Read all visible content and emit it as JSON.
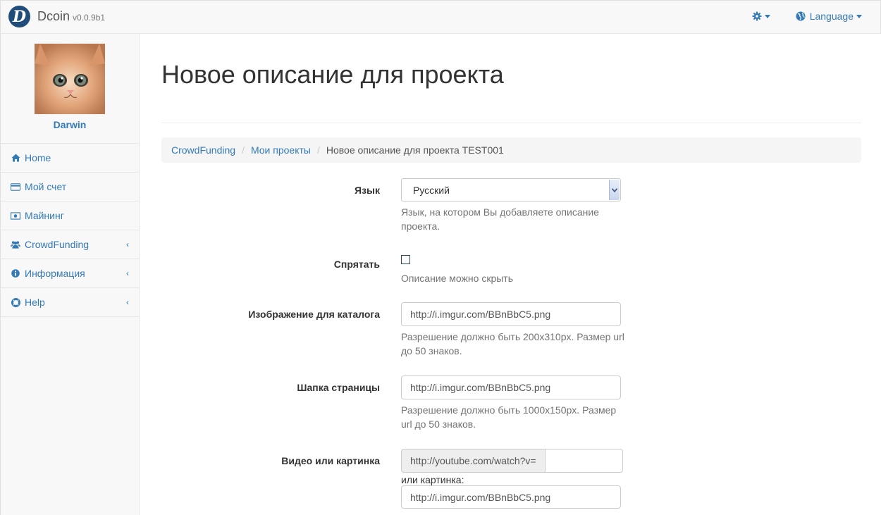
{
  "navbar": {
    "logo_letter": "D",
    "brand": "Dcoin",
    "version": "v0.0.9b1",
    "settings_icon": "gear-icon",
    "language_label": "Language",
    "language_icon": "globe-icon"
  },
  "sidebar": {
    "user_name": "Darwin",
    "items": [
      {
        "label": "Home",
        "icon": "home-icon",
        "expandable": false
      },
      {
        "label": "Мой счет",
        "icon": "credit-card-icon",
        "expandable": false
      },
      {
        "label": "Майнинг",
        "icon": "money-icon",
        "expandable": false
      },
      {
        "label": "CrowdFunding",
        "icon": "users-icon",
        "expandable": true
      },
      {
        "label": "Информация",
        "icon": "info-circle-icon",
        "expandable": true
      },
      {
        "label": "Help",
        "icon": "life-ring-icon",
        "expandable": true
      }
    ]
  },
  "main": {
    "title": "Новое описание для проекта",
    "breadcrumb": [
      "CrowdFunding",
      "Мои проекты",
      "Новое описание для проекта TEST001"
    ]
  },
  "form": {
    "language": {
      "label": "Язык",
      "value": "Русский",
      "help": "Язык, на котором Вы добавляете описание проекта."
    },
    "hide": {
      "label": "Спрятать",
      "checked": false,
      "help": "Описание можно скрыть"
    },
    "catalog_image": {
      "label": "Изображение для каталога",
      "value": "http://i.imgur.com/BBnBbC5.png",
      "help": "Разрешение должно быть 200x310px. Размер url до 50 знаков."
    },
    "page_header": {
      "label": "Шапка страницы",
      "value": "http://i.imgur.com/BBnBbC5.png",
      "help": "Разрешение должно быть 1000x150px. Размер url до 50 знаков."
    },
    "video_or_image": {
      "label": "Видео или картинка",
      "video_prefix": "http://youtube.com/watch?v=",
      "video_value": "",
      "or_label": "или картинка:",
      "image_value": "http://i.imgur.com/BBnBbC5.png"
    }
  },
  "colors": {
    "link": "#337ab7",
    "brand_logo": "#1f4d7a"
  }
}
